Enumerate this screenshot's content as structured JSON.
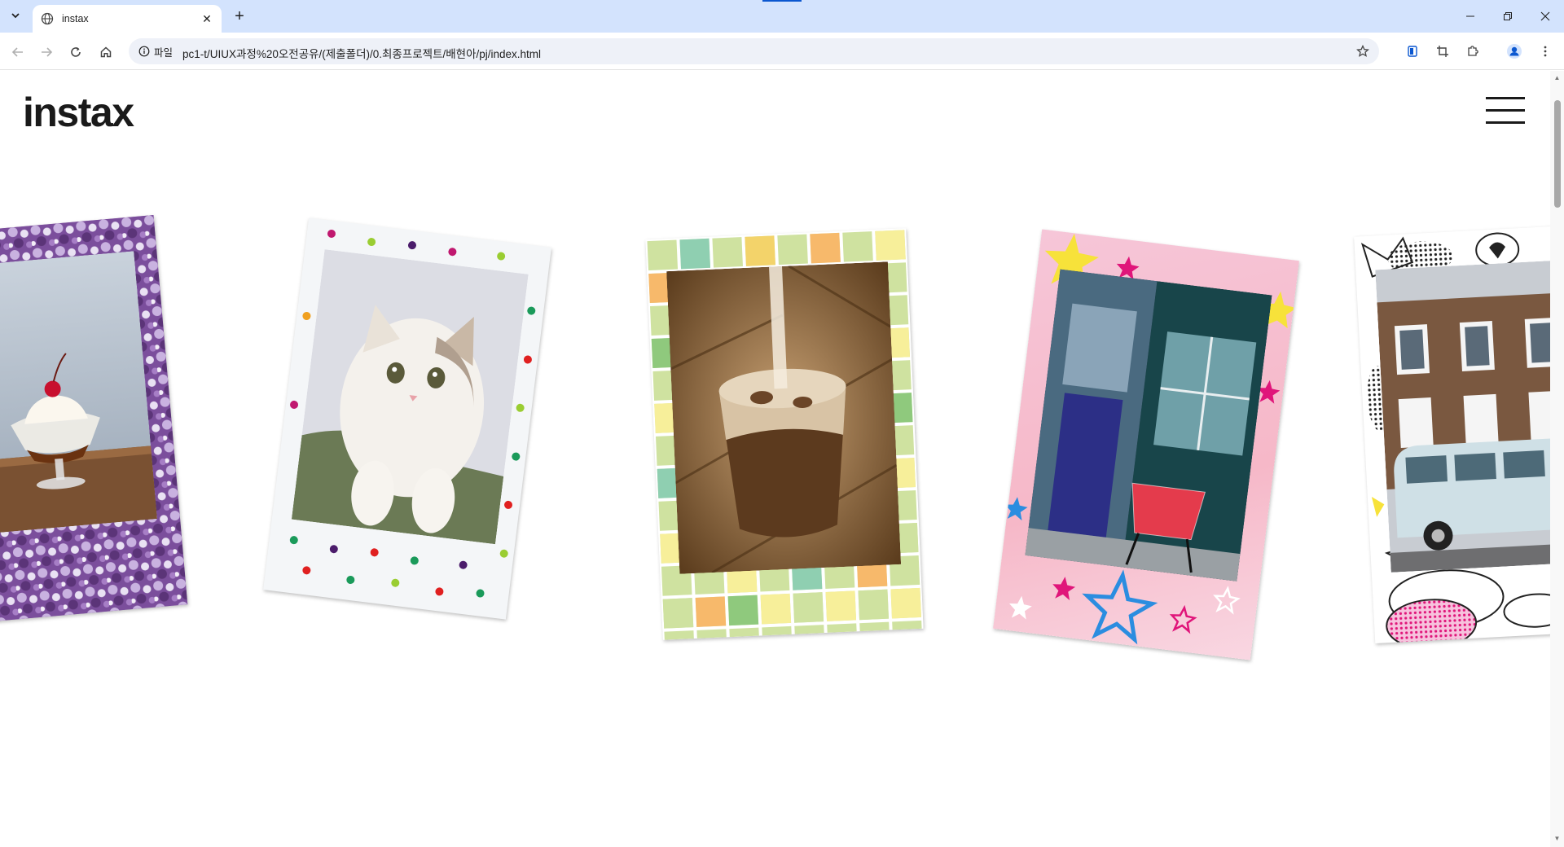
{
  "browser": {
    "tab_title": "instax",
    "site_info_label": "파일",
    "url": "pc1-t/UIUX과정%20오전공유/(제출폴더)/0.최종프로젝트/배현아/pj/index.html"
  },
  "page": {
    "logo_text": "instax"
  },
  "cards": [
    {
      "frame": "glitter-purple",
      "photo": "ice-cream-sundae"
    },
    {
      "frame": "colorful-dots",
      "photo": "white-cat"
    },
    {
      "frame": "pastel-grid",
      "photo": "iced-coffee"
    },
    {
      "frame": "pink-stars",
      "photo": "blue-door-cafe"
    },
    {
      "frame": "comic-pop",
      "photo": "house-with-van"
    }
  ],
  "colors": {
    "tabbar_bg": "#d3e3fd",
    "accent": "#0b57d0",
    "text": "#1a1a1a"
  }
}
